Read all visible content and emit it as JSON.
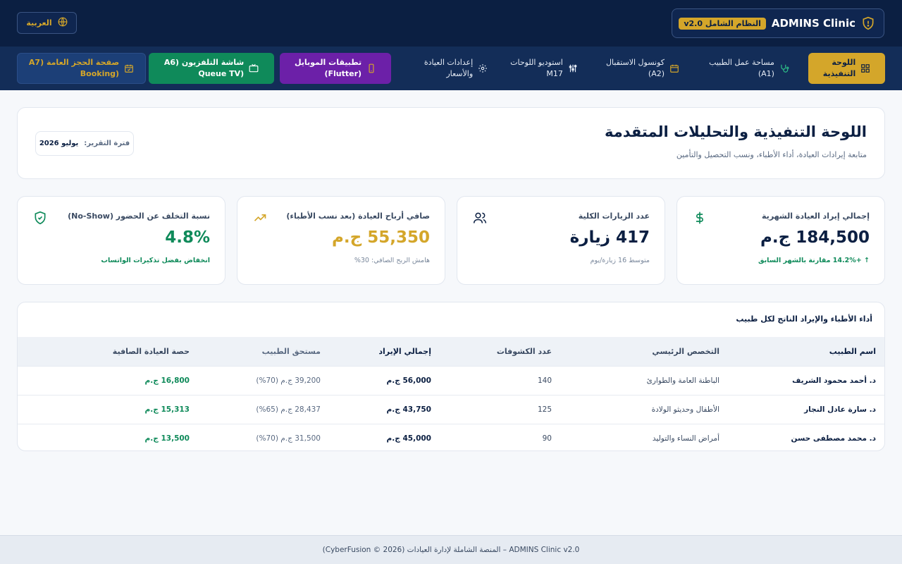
{
  "header": {
    "brand_title": "ADMINS Clinic",
    "brand_badge": "النظام الشامل v2.0",
    "language_button": "العربية"
  },
  "nav": {
    "executive_dashboard": "اللوحة\nالتنفيذية",
    "doctor_workspace": "مساحة عمل الطبيب\n(A1)",
    "reception_console": "كونسول الاستقبال\n(A2)",
    "boards_studio": "استوديو اللوحات\nM17",
    "clinic_settings": "إعدادات العيادة\nوالأسعار",
    "mobile_apps": "تطبيقات الموبايل\n(Flutter)",
    "tv_screen": "شاشة التلفزيون (A6\n(Queue TV",
    "booking_page": "صفحة الحجز العامة (A7\n(Booking"
  },
  "page": {
    "title": "اللوحة التنفيذية والتحليلات المتقدمة",
    "subtitle": "متابعة إيرادات العيادة، أداء الأطباء، ونسب التحصيل والتأمين",
    "period_label": "فترة التقرير:",
    "period_value": "يوليو 2026"
  },
  "kpis": [
    {
      "label": "إجمالي إيراد العيادة الشهرية",
      "value": "184,500 ج.م",
      "note": "↑ +14.2% مقارنة بالشهر السابق",
      "icon": "dollar-icon"
    },
    {
      "label": "عدد الزيارات الكلية",
      "value": "417 زيارة",
      "note": "متوسط 16 زيارة/يوم",
      "icon": "users-icon"
    },
    {
      "label": "صافي أرباح العيادة (بعد نسب الأطباء)",
      "value": "55,350 ج.م",
      "note": "هامش الربح الصافي: 30%",
      "icon": "trending-up-icon"
    },
    {
      "label": "نسبة التخلف عن الحضور (No-Show)",
      "value": "4.8%",
      "note": "انخفاض بفضل تذكيرات الواتساب",
      "icon": "shield-check-icon"
    }
  ],
  "doctors_table": {
    "title": "أداء الأطباء والإيراد الناتج لكل طبيب",
    "columns": [
      "اسم الطبيب",
      "التخصص الرئيسي",
      "عدد الكشوفات",
      "إجمالي الإيراد",
      "مستحق الطبيب",
      "حصة العيادة الصافية"
    ],
    "rows": [
      [
        "د. أحمد محمود الشريف",
        "الباطنة العامة والطوارئ",
        "140",
        "56,000 ج.م",
        "39,200 ج.م (70%)",
        "16,800 ج.م"
      ],
      [
        "د. سارة عادل النجار",
        "الأطفال وحديثو الولادة",
        "125",
        "43,750 ج.م",
        "28,437 ج.م (65%)",
        "15,313 ج.م"
      ],
      [
        "د. محمد مصطفى حسن",
        "أمراض النساء والتوليد",
        "90",
        "45,000 ج.م",
        "31,500 ج.م (70%)",
        "13,500 ج.م"
      ]
    ]
  },
  "footer": {
    "text": "ADMINS Clinic v2.0 – المنصة الشاملة لإدارة العيادات (2026 © CyberFusion)"
  },
  "colors": {
    "navy": "#0b1f42",
    "gold": "#d4a62a",
    "green": "#0f8a5a",
    "purple": "#6c20a8"
  }
}
